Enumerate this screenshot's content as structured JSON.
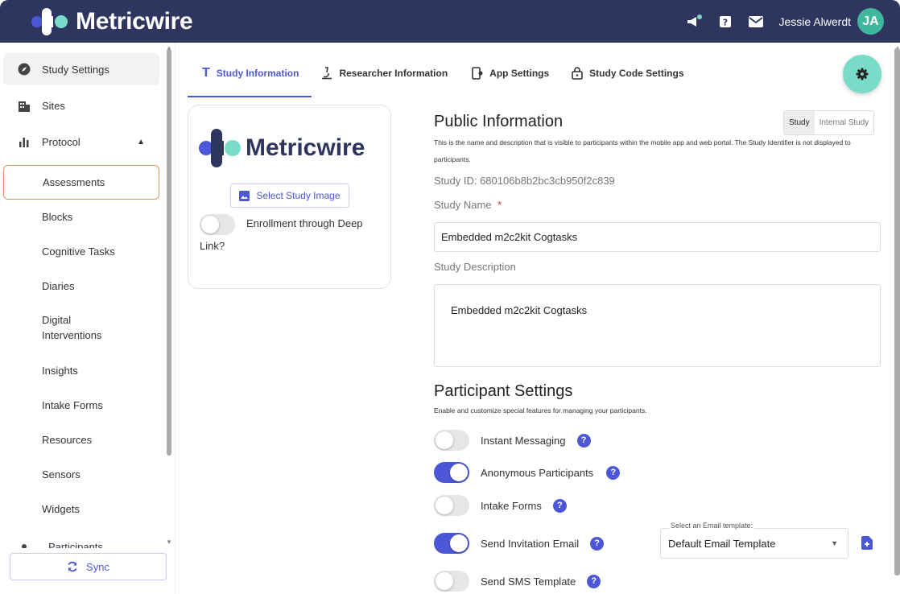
{
  "app": {
    "name": "Metricwire"
  },
  "topbar": {
    "user_name": "Jessie Alwerdt",
    "avatar_initials": "JA",
    "icons": [
      "megaphone-icon",
      "help-icon",
      "mail-icon"
    ]
  },
  "sidebar": {
    "items": [
      {
        "label": "Study Settings",
        "icon": "compass-icon"
      },
      {
        "label": "Sites",
        "icon": "building-icon"
      },
      {
        "label": "Protocol",
        "icon": "bar-chart-icon"
      },
      {
        "label": "Assessments"
      },
      {
        "label": "Blocks"
      },
      {
        "label": "Cognitive Tasks"
      },
      {
        "label": "Diaries"
      },
      {
        "label": "Digital Interventions"
      },
      {
        "label": "Insights"
      },
      {
        "label": "Intake Forms"
      },
      {
        "label": "Resources"
      },
      {
        "label": "Sensors"
      },
      {
        "label": "Widgets"
      },
      {
        "label": "Participants"
      }
    ],
    "sync_label": "Sync"
  },
  "tabs": [
    {
      "label": "Study Information",
      "icon": "text-t-icon"
    },
    {
      "label": "Researcher Information",
      "icon": "microscope-icon"
    },
    {
      "label": "App Settings",
      "icon": "phone-settings-icon"
    },
    {
      "label": "Study Code Settings",
      "icon": "lock-icon"
    }
  ],
  "card": {
    "logo_text": "Metricwire",
    "select_image_label": "Select Study Image",
    "deep_link_label": "Enrollment through Deep Link?",
    "deep_link_enabled": false
  },
  "public_info": {
    "title": "Public Information",
    "description": "This is the name and description that is visible to participants within the mobile app and web portal. The Study Identifier is not displayed to participants.",
    "study_id": "Study ID: 680106b8b2bc3cb950f2c839",
    "segment": {
      "options": [
        "Study",
        "Internal Study"
      ],
      "selected": "Study"
    },
    "study_name_label": "Study Name",
    "required_mark": "*",
    "study_name_value": "Embedded m2c2kit Cogtasks",
    "study_description_label": "Study Description",
    "study_description_value": "Embedded m2c2kit Cogtasks"
  },
  "participant_settings": {
    "title": "Participant Settings",
    "description": "Enable and customize special features for managing your participants.",
    "settings": [
      {
        "label": "Instant Messaging",
        "enabled": false
      },
      {
        "label": "Anonymous Participants",
        "enabled": true
      },
      {
        "label": "Intake Forms",
        "enabled": false
      },
      {
        "label": "Send Invitation Email",
        "enabled": true
      },
      {
        "label": "Send SMS Template",
        "enabled": false
      }
    ],
    "help_glyph": "?",
    "email_template_label": "Select an Email template:",
    "email_template_value": "Default Email Template"
  },
  "colors": {
    "topbar": "#2e3660",
    "accent": "#4b57d6",
    "teal": "#79dcc8",
    "selected_border": "#e7915c"
  }
}
